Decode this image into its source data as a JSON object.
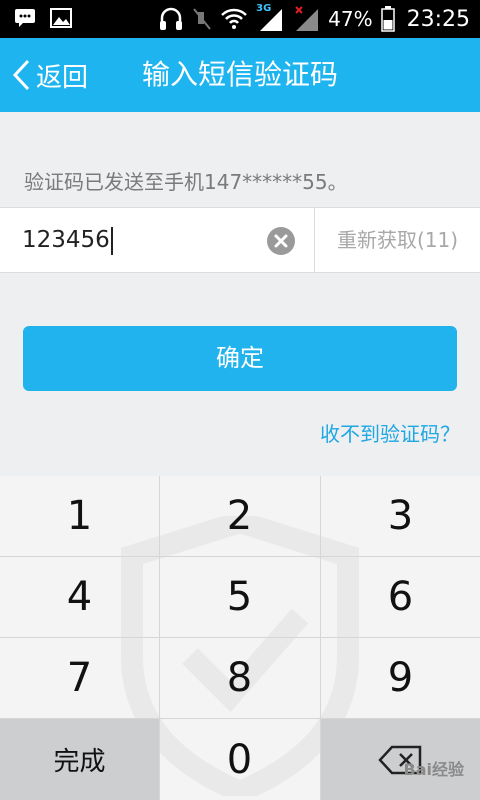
{
  "status_bar": {
    "battery_percent": "47%",
    "time": "23:25",
    "network_label": "3G",
    "icons": [
      "message-icon",
      "image-icon",
      "headphones-icon",
      "mute-icon",
      "wifi-icon",
      "signal-3g-icon",
      "signal-icon",
      "battery-icon"
    ]
  },
  "title_bar": {
    "back_label": "返回",
    "title": "输入短信验证码"
  },
  "content": {
    "sent_info": "验证码已发送至手机147******55。",
    "code_value": "123456",
    "resend_label": "重新获取(11)",
    "confirm_label": "确定",
    "no_code_link": "收不到验证码？"
  },
  "keypad": {
    "keys": [
      "1",
      "2",
      "3",
      "4",
      "5",
      "6",
      "7",
      "8",
      "9"
    ],
    "done_label": "完成",
    "zero_label": "0"
  },
  "watermark": {
    "brand": "Bai经验"
  },
  "colors": {
    "accent": "#1eb4ef",
    "link": "#1fa7e4",
    "background": "#eeeff1"
  }
}
